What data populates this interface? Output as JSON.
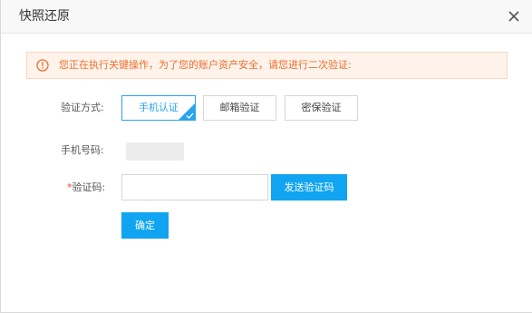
{
  "dialog": {
    "title": "快照还原",
    "close_icon": "close-icon"
  },
  "alert": {
    "icon": "exclamation-circle-icon",
    "text": "您正在执行关键操作，为了您的账户资产安全，请您进行二次验证:",
    "color": "#ee6e2c",
    "background": "#fef3eb"
  },
  "form": {
    "method_label": "验证方式:",
    "methods": [
      {
        "label": "手机认证",
        "selected": true
      },
      {
        "label": "邮箱验证",
        "selected": false
      },
      {
        "label": "密保验证",
        "selected": false
      }
    ],
    "phone_label": "手机号码:",
    "code_required_mark": "*",
    "code_label": "验证码:",
    "code_value": "",
    "send_code_label": "发送验证码",
    "confirm_label": "确定"
  },
  "colors": {
    "accent": "#10a4f1",
    "selected_border": "#2aa4ee"
  }
}
